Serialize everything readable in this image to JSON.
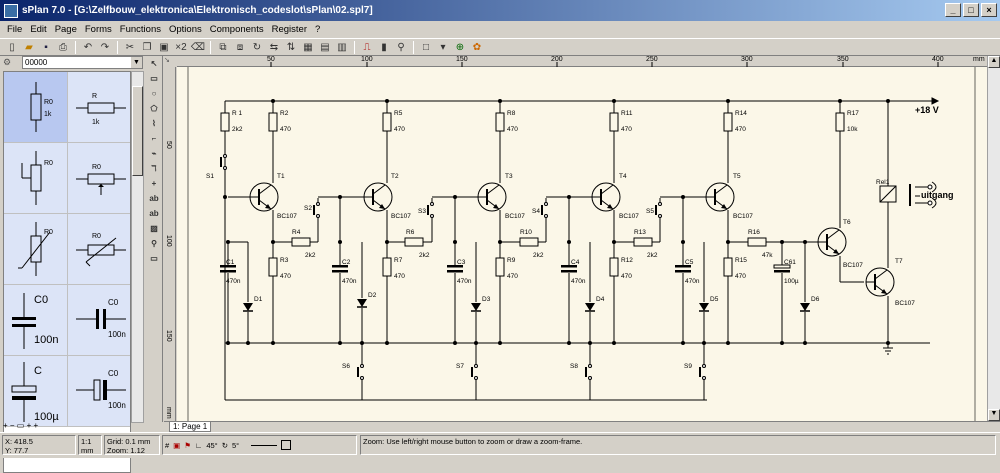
{
  "window": {
    "title": "sPlan 7.0 - [G:\\Zelfbouw_elektronica\\Elektronisch_codeslot\\sPlan\\02.spl7]",
    "buttons": [
      "_",
      "□",
      "×"
    ]
  },
  "menu": [
    {
      "label": "File"
    },
    {
      "label": "Edit"
    },
    {
      "label": "Page"
    },
    {
      "label": "Forms"
    },
    {
      "label": "Functions"
    },
    {
      "label": "Options"
    },
    {
      "label": "Components"
    },
    {
      "label": "Register"
    },
    {
      "label": "?"
    }
  ],
  "library": {
    "selector_value": "00000",
    "components": [
      {
        "name": "R0",
        "value": "1k"
      },
      {
        "name": "R",
        "value": "1k"
      },
      {
        "name": "R0",
        "value": ""
      },
      {
        "name": "R0",
        "value": ""
      },
      {
        "name": "R0",
        "value": ""
      },
      {
        "name": "R0",
        "value": ""
      },
      {
        "name": "C0",
        "value": "100n"
      },
      {
        "name": "C0",
        "value": "100n"
      },
      {
        "name": "C",
        "value": "100µ"
      },
      {
        "name": "C0",
        "value": "100n"
      }
    ]
  },
  "ruler": {
    "top_ticks": [
      "50",
      "100",
      "150",
      "200",
      "250",
      "300",
      "350",
      "400"
    ],
    "unit": "mm",
    "left_ticks": [
      "50",
      "100",
      "150"
    ]
  },
  "schematic": {
    "supply_label": "+18 V",
    "output_label": "uitgang",
    "relay_label": "Rel1",
    "components": {
      "R1": {
        "name": "R 1",
        "value": "2k2"
      },
      "R2": {
        "name": "R2",
        "value": "470"
      },
      "R3": {
        "name": "R3",
        "value": "470"
      },
      "R4": {
        "name": "R4",
        "value": "2k2"
      },
      "R5": {
        "name": "R5",
        "value": "470"
      },
      "R6": {
        "name": "R6",
        "value": "2k2"
      },
      "R7": {
        "name": "R7",
        "value": "470"
      },
      "R8": {
        "name": "R8",
        "value": "470"
      },
      "R9": {
        "name": "R9",
        "value": "470"
      },
      "R10": {
        "name": "R10",
        "value": "2k2"
      },
      "R11": {
        "name": "R11",
        "value": "470"
      },
      "R12": {
        "name": "R12",
        "value": "470"
      },
      "R13": {
        "name": "R13",
        "value": "2k2"
      },
      "R14": {
        "name": "R14",
        "value": "470"
      },
      "R15": {
        "name": "R15",
        "value": "470"
      },
      "R16": {
        "name": "R16",
        "value": "47k"
      },
      "R17": {
        "name": "R17",
        "value": "10k"
      },
      "C1": {
        "name": "C1",
        "value": "470n"
      },
      "C2": {
        "name": "C2",
        "value": "470n"
      },
      "C3": {
        "name": "C3",
        "value": "470n"
      },
      "C4": {
        "name": "C4",
        "value": "470n"
      },
      "C5": {
        "name": "C5",
        "value": "470n"
      },
      "C61": {
        "name": "C61",
        "value": "100µ"
      },
      "T1": {
        "name": "T1",
        "value": "BC107"
      },
      "T2": {
        "name": "T2",
        "value": "BC107"
      },
      "T3": {
        "name": "T3",
        "value": "BC107"
      },
      "T4": {
        "name": "T4",
        "value": "BC107"
      },
      "T5": {
        "name": "T5",
        "value": "BC107"
      },
      "T6": {
        "name": "T6",
        "value": "BC107"
      },
      "T7": {
        "name": "T7",
        "value": "BC107"
      },
      "D1": "D1",
      "D2": "D2",
      "D3": "D3",
      "D4": "D4",
      "D5": "D5",
      "D6": "D6",
      "S1": "S1",
      "S2": "S2",
      "S3": "S3",
      "S4": "S4",
      "S5": "S5",
      "S6": "S6",
      "S7": "S7",
      "S8": "S8",
      "S9": "S9"
    }
  },
  "pages": [
    {
      "label": "1: Page 1"
    }
  ],
  "status": {
    "x": "X: 418.5",
    "y": "Y: 77.7",
    "scale": "1:1",
    "unit": "mm",
    "grid": "Grid:  0.1 mm",
    "zoom": "Zoom:  1.12",
    "angle1": "45°",
    "angle2": "5°",
    "hint": "Zoom: Use left/right mouse button to zoom or draw a zoom-frame."
  }
}
